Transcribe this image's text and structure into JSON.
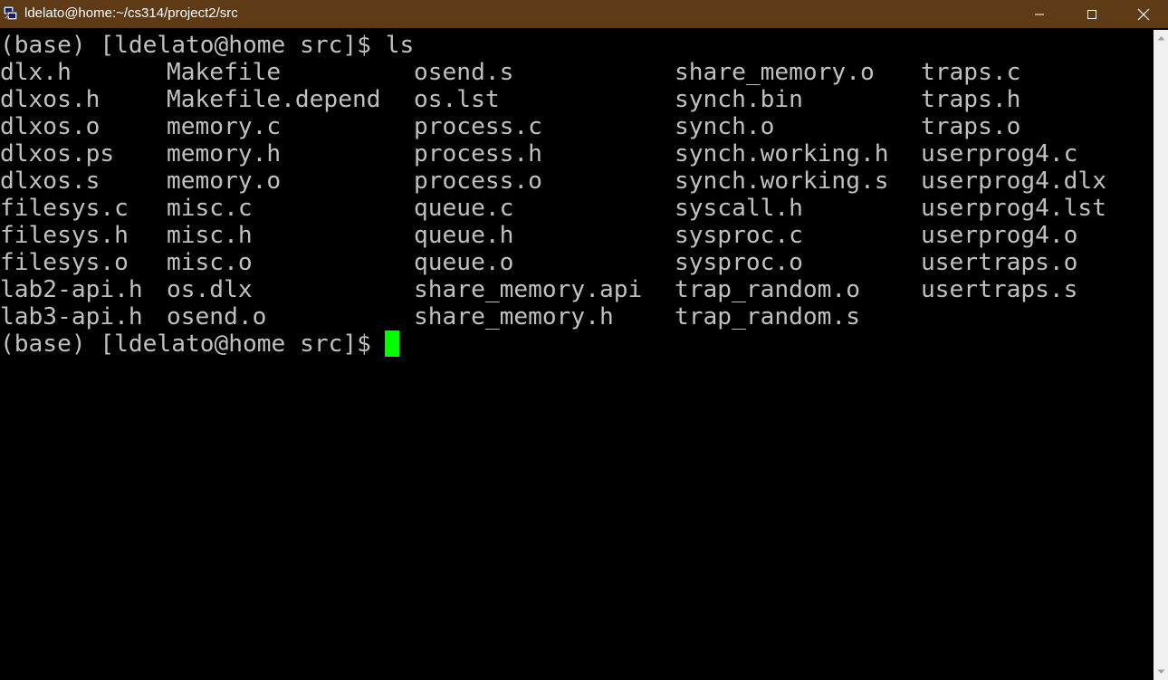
{
  "window": {
    "title": "ldelato@home:~/cs314/project2/src",
    "app_icon": "putty-icon",
    "title_bar_color": "#5e3a17"
  },
  "terminal": {
    "text_color": "#c0c0c0",
    "cursor_color": "#00ff00",
    "prompt": "(base) [ldelato@home src]$ ",
    "command": "ls",
    "columns": [
      [
        "dlx.h",
        "dlxos.h",
        "dlxos.o",
        "dlxos.ps",
        "dlxos.s",
        "filesys.c",
        "filesys.h",
        "filesys.o",
        "lab2-api.h",
        "lab3-api.h"
      ],
      [
        "Makefile",
        "Makefile.depend",
        "memory.c",
        "memory.h",
        "memory.o",
        "misc.c",
        "misc.h",
        "misc.o",
        "os.dlx",
        "osend.o"
      ],
      [
        "osend.s",
        "os.lst",
        "process.c",
        "process.h",
        "process.o",
        "queue.c",
        "queue.h",
        "queue.o",
        "share_memory.api",
        "share_memory.h"
      ],
      [
        "share_memory.o",
        "synch.bin",
        "synch.o",
        "synch.working.h",
        "synch.working.s",
        "syscall.h",
        "sysproc.c",
        "sysproc.o",
        "trap_random.o",
        "trap_random.s"
      ],
      [
        "traps.c",
        "traps.h",
        "traps.o",
        "userprog4.c",
        "userprog4.dlx",
        "userprog4.lst",
        "userprog4.o",
        "usertraps.o",
        "usertraps.s"
      ]
    ],
    "second_prompt": "(base) [ldelato@home src]$ "
  },
  "scrollbar": {
    "up_icon": "scroll-up-arrow-icon",
    "down_icon": "scroll-down-arrow-icon"
  }
}
